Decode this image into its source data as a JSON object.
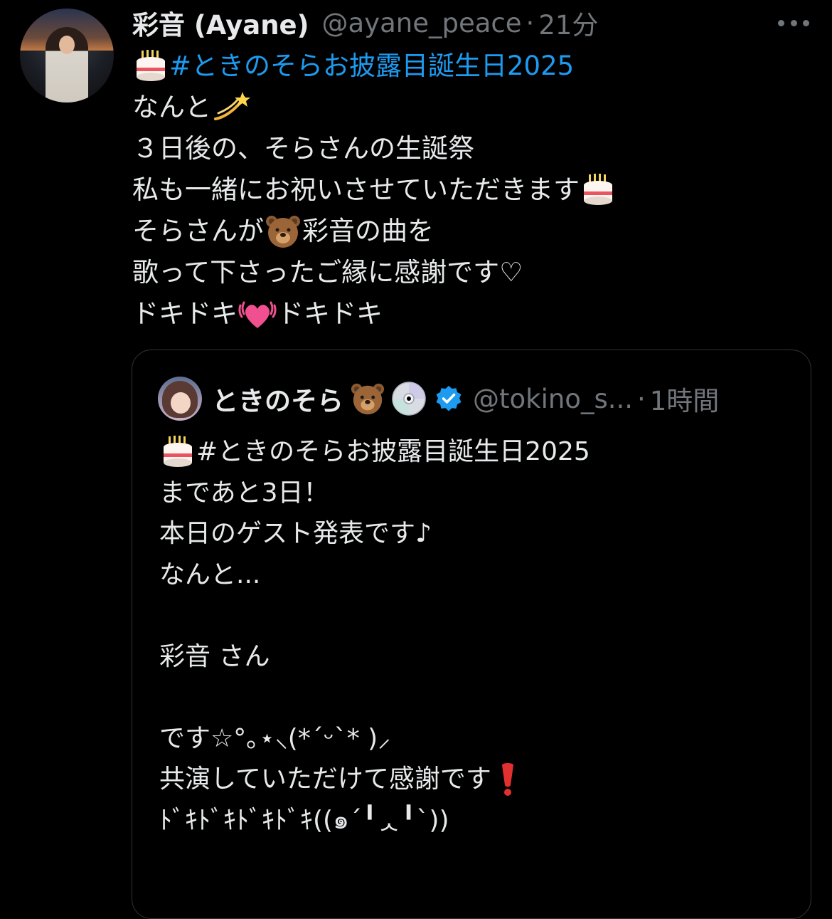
{
  "tweet": {
    "display_name": "彩音 (Ayane)",
    "handle": "@ayane_peace",
    "separator": "·",
    "time": "21分",
    "avatar_icon": "user-avatar",
    "more_icon": "more-horizontal-icon",
    "lines": [
      {
        "emoji": "birthday-cake-emoji",
        "text": "#ときのそらお披露目誕生日2025"
      },
      {
        "text": "なんと",
        "emoji_after": "dizzy-emoji"
      },
      {
        "text": "３日後の、そらさんの生誕祭"
      },
      {
        "text": "私も一緒にお祝いさせていただきます",
        "emoji_after": "birthday-cake-emoji"
      },
      {
        "text_before": "そらさんが",
        "emoji": "bear-emoji",
        "text_after": "彩音の曲を"
      },
      {
        "text": "歌って下さったご縁に感謝です♡"
      },
      {
        "text_before": "ドキドキ",
        "emoji": "beating-heart-emoji",
        "text_after": "ドキドキ"
      }
    ]
  },
  "quote": {
    "display_name": "ときのそら",
    "name_emojis": [
      "bear-emoji",
      "cd-emoji"
    ],
    "verified_icon": "verified-badge-icon",
    "handle": "@tokino_s...",
    "separator": "·",
    "time": "1時間",
    "lines": [
      {
        "emoji": "birthday-cake-emoji",
        "text": "#ときのそらお披露目誕生日2025"
      },
      {
        "text": "まであと3日！"
      },
      {
        "text": "本日のゲスト発表です♪"
      },
      {
        "text": "なんと..."
      },
      {
        "text": ""
      },
      {
        "text": "彩音 さん"
      },
      {
        "text": ""
      },
      {
        "text": "です☆°｡⋆⸜(*ˊᵕˋ* )⸝"
      },
      {
        "text": "共演していただけて感謝です",
        "emoji_after": "heavy-exclamation-emoji"
      },
      {
        "text": "ﾄﾞｷﾄﾞｷﾄﾞｷﾄﾞｷ((๑ˊ╹ᆺ╹ˋ))"
      }
    ]
  },
  "colors": {
    "background": "#000000",
    "text": "#e7e9ea",
    "secondary": "#71767b",
    "link": "#1d9bf0",
    "border": "#2f3336",
    "verified": "#1d9bf0"
  }
}
